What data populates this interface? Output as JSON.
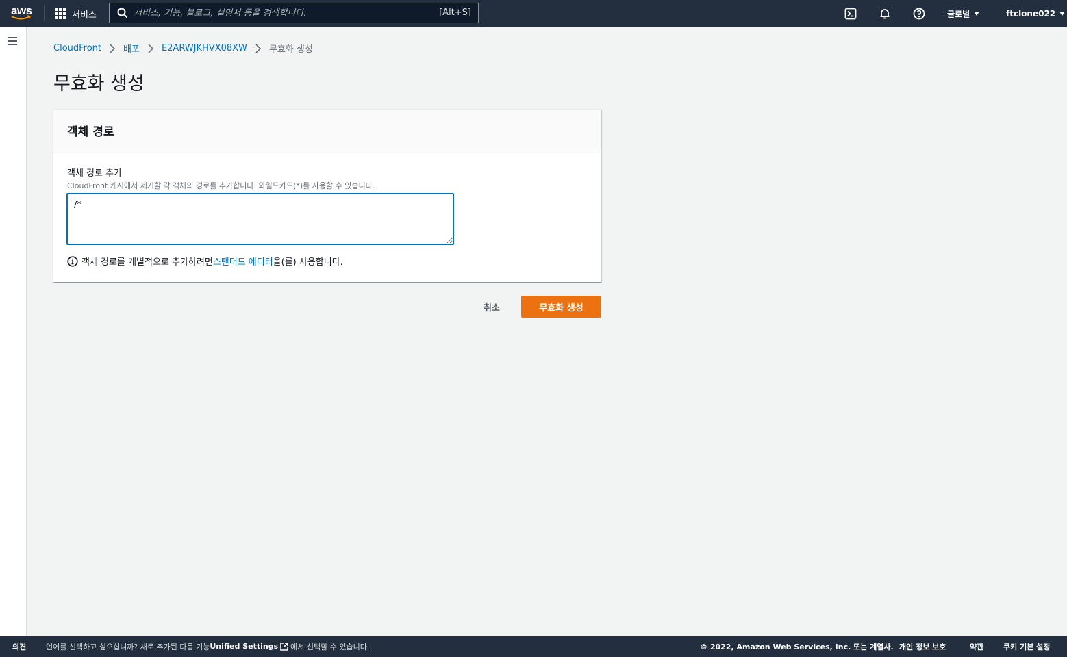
{
  "topnav": {
    "logo_text": "aws",
    "services_label": "서비스",
    "search_placeholder": "서비스, 기능, 블로그, 설명서 등을 검색합니다.",
    "search_shortcut": "[Alt+S]",
    "region_label": "글로벌",
    "account_label": "ftclone022",
    "icons": [
      "cloudshell-icon",
      "notifications-bell-icon",
      "help-icon"
    ]
  },
  "breadcrumb": {
    "items": [
      "CloudFront",
      "배포",
      "E2ARWJKHVX08XW"
    ],
    "current": "무효화 생성"
  },
  "page": {
    "title": "무효화 생성"
  },
  "panel": {
    "title": "객체 경로",
    "field_label": "객체 경로 추가",
    "field_description": "CloudFront 캐시에서 제거할 각 객체의 경로를 추가합니다. 와일드카드(*)를 사용할 수 있습니다.",
    "textarea_value": "/*",
    "info_prefix": "객체 경로를 개별적으로 추가하려면 ",
    "info_link": "스탠더드 에디터",
    "info_suffix": "을(를) 사용합니다."
  },
  "actions": {
    "cancel_label": "취소",
    "submit_label": "무효화 생성",
    "submit_color": "#ec7211"
  },
  "footer": {
    "feedback": "의견",
    "language_prefix": "언어를 선택하고 싶으십니까? 새로 추가된 다음 기능",
    "unified_settings": "Unified Settings",
    "language_suffix": "에서 선택할 수 있습니다.",
    "copyright": "© 2022, Amazon Web Services, Inc. 또는 계열사.",
    "privacy": "개인 정보 보호",
    "terms": "약관",
    "cookie_prefs": "쿠키 기본 설정"
  },
  "colors": {
    "nav_bg": "#232f3e",
    "link": "#0073bb",
    "page_bg": "#f2f3f3"
  }
}
